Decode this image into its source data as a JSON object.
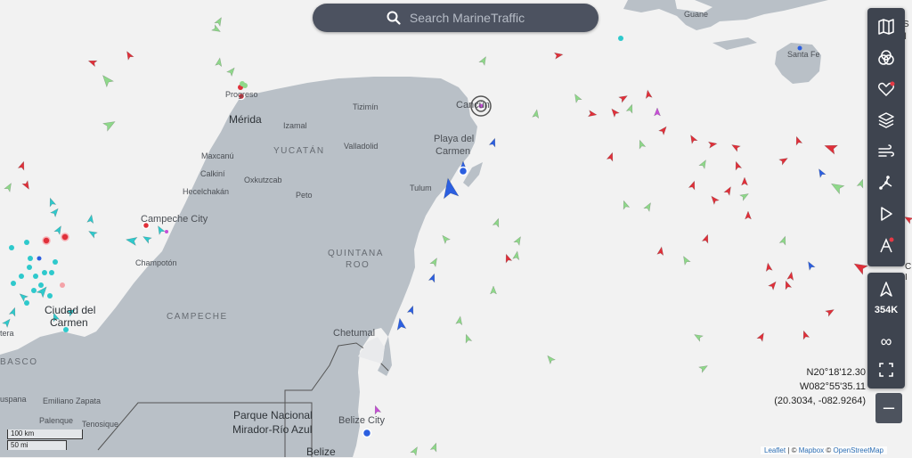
{
  "search": {
    "placeholder": "Search MarineTraffic",
    "icon": "search-icon"
  },
  "map_labels": [
    {
      "id": "guane",
      "text": "Guane",
      "cls": "small"
    },
    {
      "id": "santa-fe",
      "text": "Santa Fe",
      "cls": "small"
    },
    {
      "id": "merida",
      "text": "Mérida",
      "cls": "big"
    },
    {
      "id": "progreso",
      "text": "Progreso",
      "cls": "small"
    },
    {
      "id": "izamal",
      "text": "Izamal",
      "cls": "small"
    },
    {
      "id": "tizimin",
      "text": "Tizimín",
      "cls": "small"
    },
    {
      "id": "cancun",
      "text": "Cancún",
      "cls": "city"
    },
    {
      "id": "valladolid",
      "text": "Valladolid",
      "cls": "small"
    },
    {
      "id": "yucatan",
      "text": "YUCATÁN",
      "cls": "region"
    },
    {
      "id": "maxcanu",
      "text": "Maxcanú",
      "cls": "small"
    },
    {
      "id": "calkini",
      "text": "Calkiní",
      "cls": "small"
    },
    {
      "id": "oxkutzcab",
      "text": "Oxkutzcab",
      "cls": "small"
    },
    {
      "id": "hecelchakan",
      "text": "Hecelchakán",
      "cls": "small"
    },
    {
      "id": "peto",
      "text": "Peto",
      "cls": "small"
    },
    {
      "id": "playa",
      "text": "Playa del",
      "cls": "city"
    },
    {
      "id": "carmen",
      "text": "Carmen",
      "cls": "city"
    },
    {
      "id": "tulum",
      "text": "Tulum",
      "cls": "small"
    },
    {
      "id": "campeche-city",
      "text": "Campeche City",
      "cls": "city"
    },
    {
      "id": "champoton",
      "text": "Champotón",
      "cls": "small"
    },
    {
      "id": "quintana",
      "text": "QUINTANA",
      "cls": "region"
    },
    {
      "id": "roo",
      "text": "ROO",
      "cls": "region"
    },
    {
      "id": "ciudad",
      "text": "Ciudad del",
      "cls": "big"
    },
    {
      "id": "ciudad2",
      "text": "Carmen",
      "cls": "big"
    },
    {
      "id": "campeche-state",
      "text": "CAMPECHE",
      "cls": "region"
    },
    {
      "id": "chetumal",
      "text": "Chetumal",
      "cls": "city"
    },
    {
      "id": "tera",
      "text": "tera",
      "cls": "small"
    },
    {
      "id": "basco",
      "text": "BASCO",
      "cls": "region"
    },
    {
      "id": "uspana",
      "text": "uspana",
      "cls": "small"
    },
    {
      "id": "emiliano",
      "text": "Emiliano Zapata",
      "cls": "small"
    },
    {
      "id": "palenque",
      "text": "Palenque",
      "cls": "small"
    },
    {
      "id": "tenosique",
      "text": "Tenosique",
      "cls": "small"
    },
    {
      "id": "parque",
      "text": "Parque Nacional",
      "cls": "big"
    },
    {
      "id": "mirador",
      "text": "Mirador-Río Azul",
      "cls": "big"
    },
    {
      "id": "belize-city",
      "text": "Belize City",
      "cls": "city"
    },
    {
      "id": "belize",
      "text": "Belize",
      "cls": "big"
    }
  ],
  "toolbar": [
    {
      "name": "map-layers-button",
      "icon": "map-icon"
    },
    {
      "name": "filters-button",
      "icon": "circles-icon"
    },
    {
      "name": "my-fleets-button",
      "icon": "heart-icon",
      "locked": true
    },
    {
      "name": "layers-button",
      "icon": "stack-icon"
    },
    {
      "name": "weather-button",
      "icon": "wind-icon"
    },
    {
      "name": "measure-button",
      "icon": "measure-icon"
    },
    {
      "name": "playback-button",
      "icon": "play-icon"
    },
    {
      "name": "routing-button",
      "icon": "route-icon",
      "locked": true
    }
  ],
  "zoom": {
    "locate_icon": "navigation-arrow-icon",
    "count": "354K",
    "infinity": "∞",
    "fullscreen_icon": "fullscreen-icon",
    "zoom_out": "–"
  },
  "coords": {
    "lat": "N20°18'12.30",
    "lon": "W082°55'35.11",
    "decimal": "(20.3034, -082.9264)"
  },
  "scale": {
    "km": "100 km",
    "mi": "50 mi"
  },
  "attribution": {
    "leaflet": "Leaflet",
    "sep1": " | © ",
    "mapbox": "Mapbox",
    "sep2": " © ",
    "osm": "OpenStreetMap"
  },
  "colors": {
    "water": "#f2f2f2",
    "land": "#b9c0c7",
    "cargo": "#8fd88a",
    "tanker": "#e0303a",
    "passenger": "#2c5fe0",
    "fishing": "#f4a3a8",
    "tug": "#2ec9cc",
    "pleasure": "#c64fd6"
  },
  "edge_labels": [
    {
      "id": "e1",
      "text": "S"
    },
    {
      "id": "e2",
      "text": "al"
    },
    {
      "id": "e3",
      "text": "C"
    },
    {
      "id": "e4",
      "text": "I"
    }
  ]
}
